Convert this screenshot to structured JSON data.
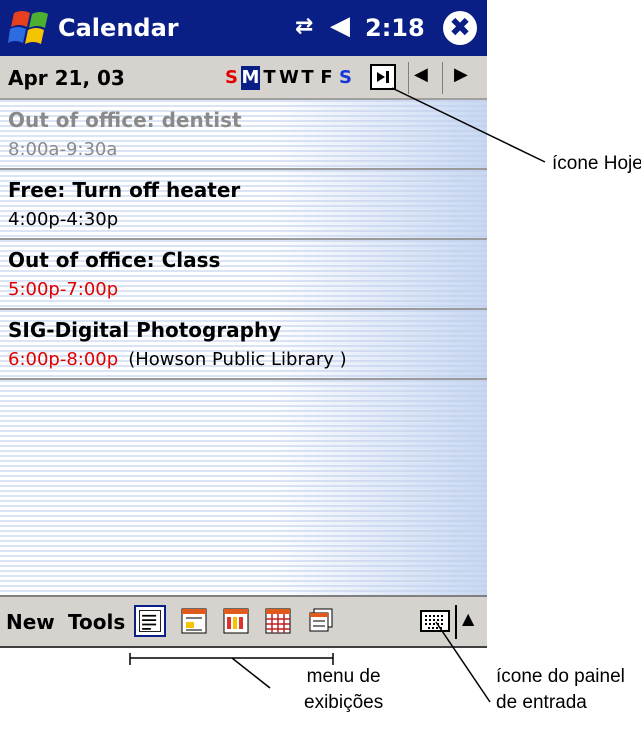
{
  "titlebar": {
    "app_title": "Calendar",
    "clock": "2:18",
    "close_label": "✖",
    "connectivity_icon": "connectivity-icon",
    "volume_icon": "speaker-icon"
  },
  "datebar": {
    "date": "Apr 21, 03",
    "weekdays": [
      "S",
      "M",
      "T",
      "W",
      "T",
      "F",
      "S"
    ],
    "selected_day_index": 1,
    "prev_label": "◀",
    "next_label": "▶"
  },
  "appointments": [
    {
      "title": "Out of office: dentist",
      "time": "8:00a-9:30a",
      "location": "",
      "status": "past"
    },
    {
      "title": "Free: Turn off heater",
      "time": "4:00p-4:30p",
      "location": "",
      "status": "normal"
    },
    {
      "title": "Out of office: Class",
      "time": "5:00p-7:00p",
      "location": "",
      "status": "conflict"
    },
    {
      "title": "SIG-Digital Photography",
      "time": "6:00p-8:00p",
      "location": "(Howson Public Library )",
      "status": "conflict"
    }
  ],
  "menubar": {
    "new_label": "New",
    "tools_label": "Tools",
    "sip_arrow": "▲"
  },
  "callouts": {
    "today": "ícone Hoje",
    "views_line1": "menu de",
    "views_line2": "exibições",
    "input_line1": "ícone do painel",
    "input_line2": "de entrada"
  },
  "colors": {
    "title_bar": "#0a1f86",
    "bar_gray": "#d6d3ce",
    "sunday": "#e00000",
    "saturday": "#1538d8",
    "conflict": "#e00000",
    "past": "#8a8a8a"
  }
}
